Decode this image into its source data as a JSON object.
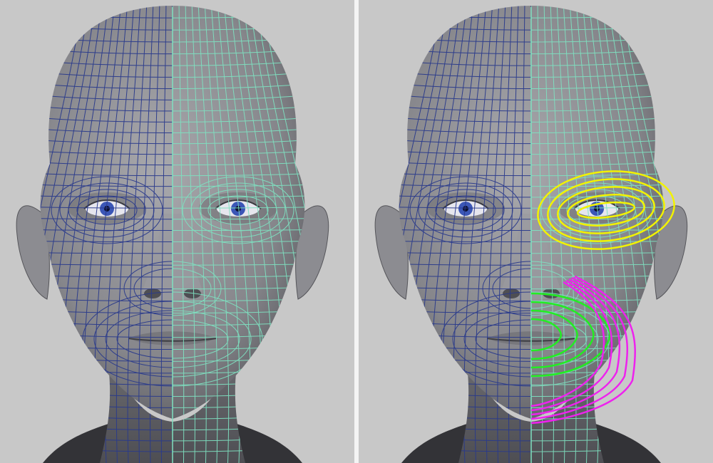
{
  "viewports": [
    {
      "id": "left",
      "view": "wireframe-on-shaded",
      "background": "#c8c8c8",
      "mesh_colors": {
        "left_half": "#2a3a8c",
        "right_half": "#7fe0c0"
      },
      "edge_loops": []
    },
    {
      "id": "right",
      "view": "wireframe-on-shaded",
      "background": "#c8c8c8",
      "mesh_colors": {
        "left_half": "#2a3a8c",
        "right_half": "#7fe0c0"
      },
      "edge_loops": [
        {
          "region": "eye",
          "color": "#f2f200",
          "count": 5
        },
        {
          "region": "mouth-inner",
          "color": "#22ee22",
          "count": 4
        },
        {
          "region": "mouth-outer",
          "color": "#ee22ee",
          "count": 5
        }
      ]
    }
  ]
}
